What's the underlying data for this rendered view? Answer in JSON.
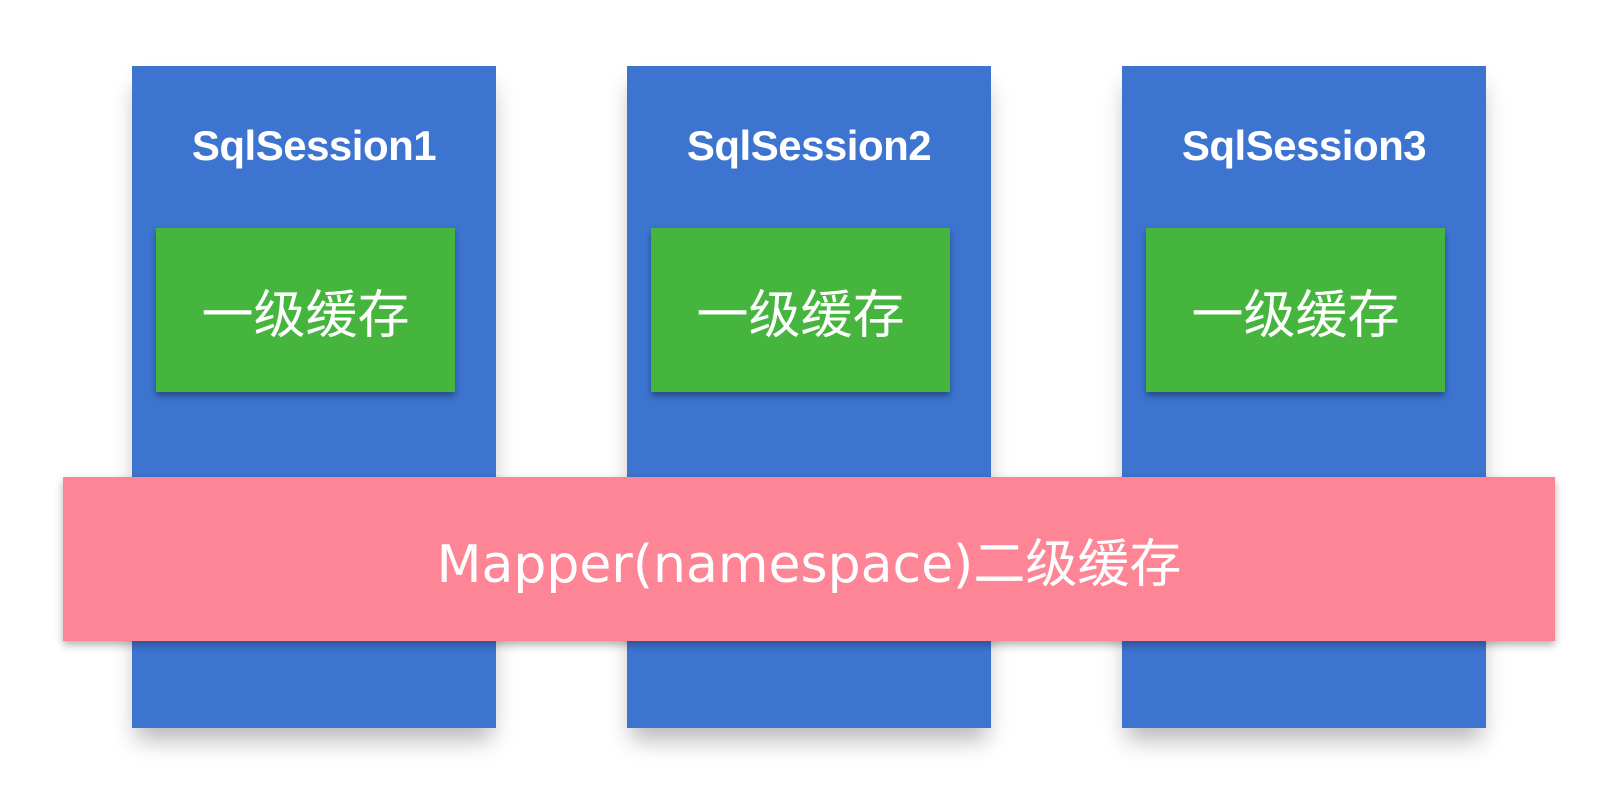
{
  "sessions": [
    {
      "title": "SqlSession1",
      "cache_label": "一级缓存"
    },
    {
      "title": "SqlSession2",
      "cache_label": "一级缓存"
    },
    {
      "title": "SqlSession3",
      "cache_label": "一级缓存"
    }
  ],
  "mapper": {
    "label": "Mapper(namespace)二级缓存"
  },
  "colors": {
    "session": "#3c74d0",
    "first_level_cache": "#45b53d",
    "second_level_cache": "#fe8596",
    "text": "#ffffff"
  }
}
